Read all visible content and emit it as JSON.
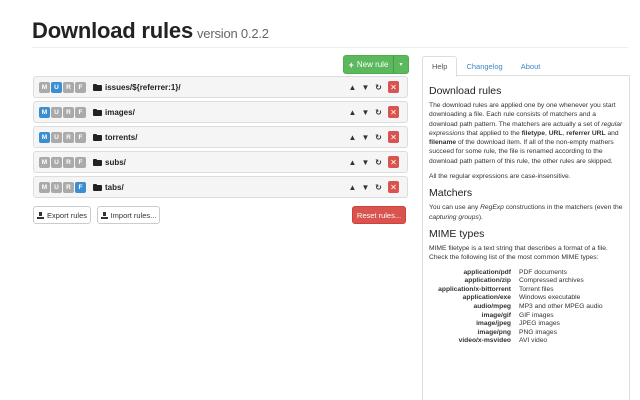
{
  "header": {
    "title": "Download rules",
    "version": "version 0.2.2"
  },
  "toolbar": {
    "new_rule_label": "New rule",
    "plus": "+",
    "caret": "▾"
  },
  "rule_badges": [
    "M",
    "U",
    "R",
    "F"
  ],
  "rule_controls": {
    "up": "▲",
    "down": "▼",
    "edit": "↻",
    "delete": "✕"
  },
  "rules": [
    {
      "path": "issues/${referrer:1}/",
      "badges": [
        false,
        true,
        false,
        false
      ]
    },
    {
      "path": "images/",
      "badges": [
        true,
        false,
        false,
        false
      ]
    },
    {
      "path": "torrents/",
      "badges": [
        true,
        false,
        false,
        false
      ]
    },
    {
      "path": "subs/",
      "badges": [
        false,
        false,
        false,
        false
      ]
    },
    {
      "path": "tabs/",
      "badges": [
        false,
        false,
        false,
        true
      ]
    }
  ],
  "actions": {
    "export_label": "Export rules",
    "import_label": "Import rules...",
    "reset_label": "Reset rules..."
  },
  "tabs": [
    {
      "label": "Help",
      "active": true
    },
    {
      "label": "Changelog",
      "active": false
    },
    {
      "label": "About",
      "active": false
    }
  ],
  "help": {
    "title": "Download rules",
    "intro_1": "The download rules are applied one by one whenever you start downloading a file. Each rule consists of matchers and a download path pattern. The matchers are actually a set of ",
    "intro_em": "regular expressions",
    "intro_2": " that applied to the ",
    "kw_filetype": "filetype",
    "sep_1": ", ",
    "kw_url": "URL",
    "sep_2": ", ",
    "kw_referrer": "referrer URL",
    "sep_3": " and ",
    "kw_filename": "filename",
    "intro_3": " of the download item. If all of the non-empty mathers succeed for some rule, the file is renamed according to the download path pattern of this rule, the other rules are skipped.",
    "case_note": "All the regular expressions are case-insensitive.",
    "matchers_title": "Matchers",
    "matchers_1": "You can use any ",
    "matchers_em1": "RegExp",
    "matchers_2": " constructions in the matchers (even the ",
    "matchers_em2": "capturing groups",
    "matchers_3": ").",
    "mime_title": "MIME types",
    "mime_intro": "MIME filetype is a text string that describes a format of a file. Check the following list of the most common MIME types:",
    "mime_types": [
      {
        "type": "application/pdf",
        "desc": "PDF documents"
      },
      {
        "type": "application/zip",
        "desc": "Compressed archives"
      },
      {
        "type": "application/x-bittorrent",
        "desc": "Torrent files"
      },
      {
        "type": "application/exe",
        "desc": "Windows executable"
      },
      {
        "type": "audio/mpeg",
        "desc": "MP3 and other MPEG audio"
      },
      {
        "type": "image/gif",
        "desc": "GIF images"
      },
      {
        "type": "image/jpeg",
        "desc": "JPEG images"
      },
      {
        "type": "image/png",
        "desc": "PNG images"
      },
      {
        "type": "video/x-msvideo",
        "desc": "AVI video"
      }
    ]
  },
  "colors": {
    "primary": "#3b8fd0",
    "success": "#5cb85c",
    "danger": "#d9534f",
    "muted": "#aaaaaa",
    "link": "#3a87c8"
  }
}
